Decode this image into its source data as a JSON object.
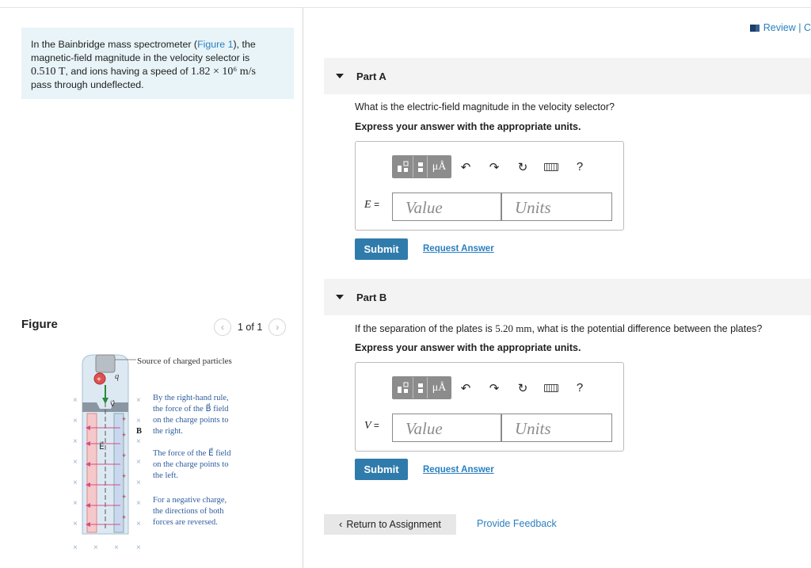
{
  "left": {
    "intro_p1": "In the Bainbridge mass spectrometer (",
    "figure_link": "Figure 1",
    "intro_p2": "), the magnetic-field magnitude in the velocity selector is",
    "intro_value_B": "0.510",
    "intro_unit_B": "T",
    "intro_p3": ", and ions having a speed of",
    "intro_speed": "1.82 × 10⁶ m/s",
    "intro_p4": "pass through undeflected.",
    "figure_title": "Figure",
    "pager_text": "1 of 1",
    "figure": {
      "source_label": "Source of charged particles",
      "charge_label": "q",
      "velocity_label": "v⃗",
      "b_label": "B⃗",
      "e_label": "E⃗",
      "text1": [
        "By the right-hand rule,",
        "the force of the B⃗ field",
        "on the charge points to",
        "the right."
      ],
      "text2": [
        "The force of the E⃗ field",
        "on the charge points to",
        "the left."
      ],
      "text3": [
        "For a negative charge,",
        "the directions of both",
        "forces are reversed."
      ]
    }
  },
  "right": {
    "review_label": "Review | C",
    "partA": {
      "title": "Part A",
      "question": "What is the electric-field magnitude in the velocity selector?",
      "instruction": "Express your answer with the appropriate units.",
      "var": "E",
      "equals": "=",
      "value_placeholder": "Value",
      "units_placeholder": "Units",
      "submit": "Submit",
      "request": "Request Answer"
    },
    "partB": {
      "title": "Part B",
      "question_p1": "If the separation of the plates is",
      "question_value": "5.20 mm",
      "question_p2": ", what is the potential difference between the plates?",
      "instruction": "Express your answer with the appropriate units.",
      "var": "V",
      "equals": "=",
      "value_placeholder": "Value",
      "units_placeholder": "Units",
      "submit": "Submit",
      "request": "Request Answer"
    },
    "toolbar": {
      "mu_label": "μÅ",
      "help_label": "?"
    },
    "return_label": "Return to Assignment",
    "feedback_label": "Provide Feedback"
  }
}
